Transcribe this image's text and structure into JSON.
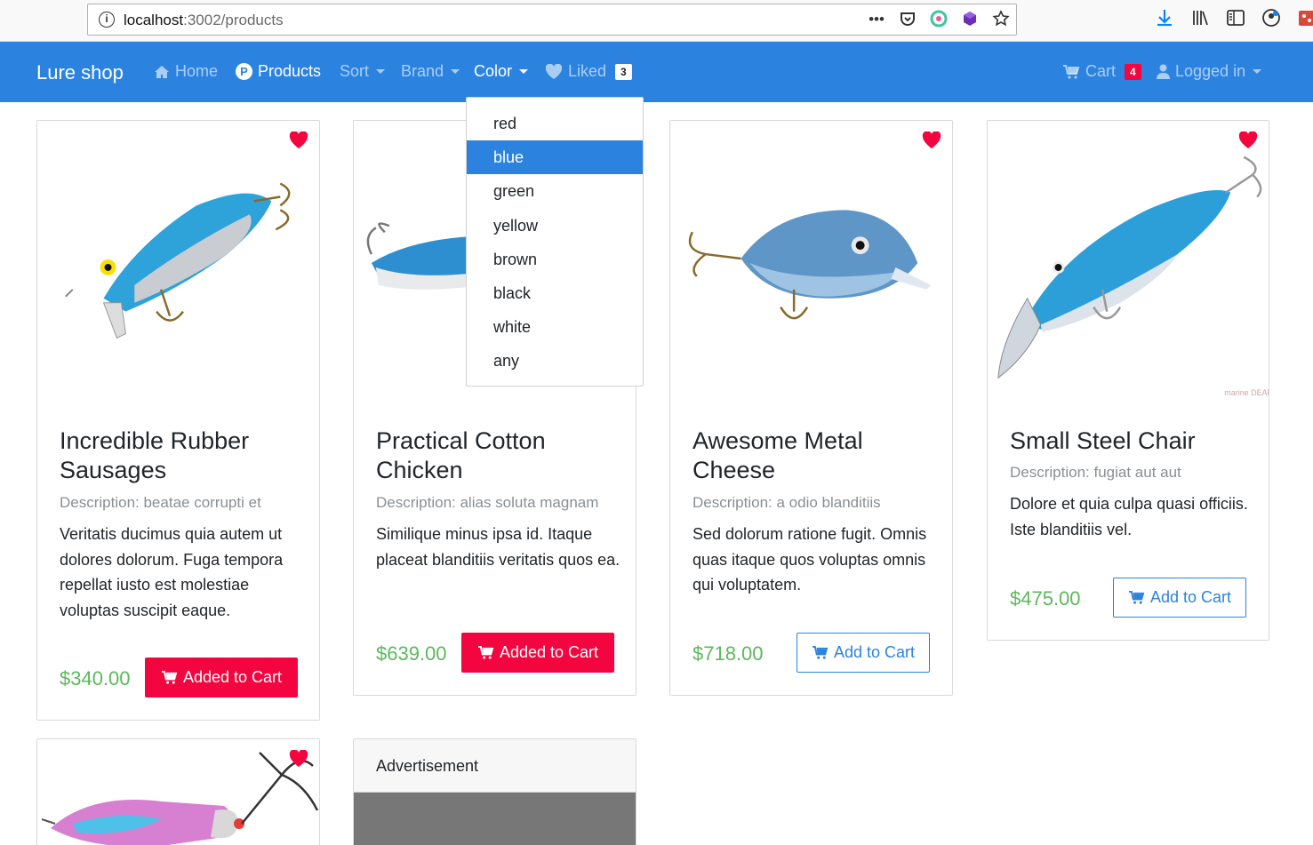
{
  "browser": {
    "url_host": "localhost",
    "url_path": ":3002/products"
  },
  "navbar": {
    "brand": "Lure shop",
    "home": "Home",
    "products": "Products",
    "products_icon_letter": "P",
    "sort": "Sort",
    "brand_menu": "Brand",
    "color": "Color",
    "liked": "Liked",
    "liked_count": "3",
    "cart": "Cart",
    "cart_count": "4",
    "logged_in": "Logged in"
  },
  "color_dropdown": {
    "options": [
      "red",
      "blue",
      "green",
      "yellow",
      "brown",
      "black",
      "white",
      "any"
    ],
    "selected": "blue"
  },
  "products": [
    {
      "title": "Incredible Rubber Sausages",
      "description": "Description: beatae corrupti et",
      "body": "Veritatis ducimus quia autem ut dolores dolorum. Fuga tempora repellat iusto est molestiae voluptas suscipit eaque.",
      "price": "$340.00",
      "button": "Added to Cart",
      "liked": true
    },
    {
      "title": "Practical Cotton Chicken",
      "description": "Description: alias soluta magnam",
      "body": "Similique minus ipsa id. Itaque placeat blanditiis veritatis quos ea.",
      "price": "$639.00",
      "button": "Added to Cart",
      "liked": false
    },
    {
      "title": "Awesome Metal Cheese",
      "description": "Description: a odio blanditiis",
      "body": "Sed dolorum ratione fugit. Omnis quas itaque quos voluptas omnis qui voluptatem.",
      "price": "$718.00",
      "button": "Add to Cart",
      "liked": true
    },
    {
      "title": "Small Steel Chair",
      "description": "Description: fugiat aut aut",
      "body": "Dolore et quia culpa quasi officiis. Iste blanditiis vel.",
      "price": "$475.00",
      "button": "Add to Cart",
      "liked": true,
      "watermark": "marine DEALS"
    },
    {
      "liked": true
    }
  ],
  "advertisement": {
    "title": "Advertisement"
  },
  "colors": {
    "primary": "#2b83df",
    "danger": "#f3063f",
    "price": "#5cb85c"
  }
}
